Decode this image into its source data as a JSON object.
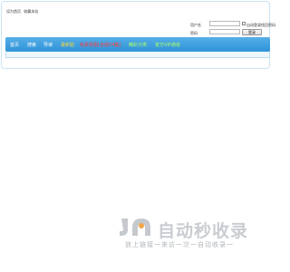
{
  "top_links": [
    "设为首页",
    "收藏本站"
  ],
  "login": {
    "username_label": "用户名",
    "password_label": "密码",
    "remember_label": "自动登录",
    "register_link": "找回密码",
    "submit_label": "登录"
  },
  "nav": [
    {
      "label": "首页",
      "color": "#ffffff"
    },
    {
      "label": "搜索",
      "color": "#ffffff"
    },
    {
      "label": "导读",
      "color": "#ffffff"
    },
    {
      "label": "最新贴",
      "color": "#ffd83a"
    },
    {
      "label": "免费观看[全部24集]",
      "color": "#ff3b3b"
    },
    {
      "label": "精彩分类",
      "color": "#aaff66"
    },
    {
      "label": "官方VIP通道",
      "color": "#aaff66"
    }
  ],
  "watermark": {
    "brand": "自动秒收录",
    "tagline": "放上链接一来访一次一自动收录一"
  }
}
